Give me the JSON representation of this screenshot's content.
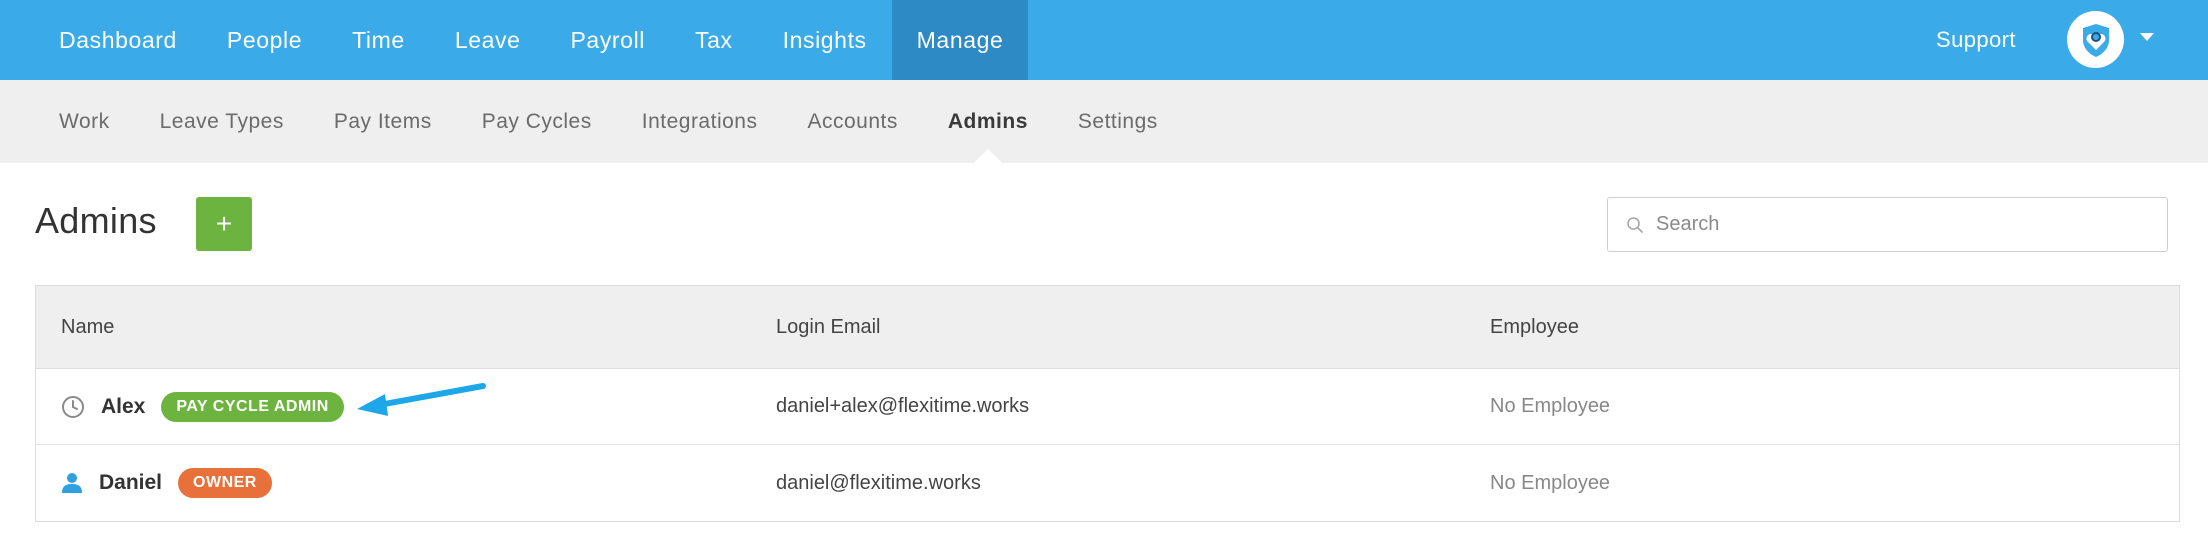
{
  "top_nav": {
    "items": [
      {
        "label": "Dashboard",
        "active": false
      },
      {
        "label": "People",
        "active": false
      },
      {
        "label": "Time",
        "active": false
      },
      {
        "label": "Leave",
        "active": false
      },
      {
        "label": "Payroll",
        "active": false
      },
      {
        "label": "Tax",
        "active": false
      },
      {
        "label": "Insights",
        "active": false
      },
      {
        "label": "Manage",
        "active": true
      }
    ],
    "support_label": "Support",
    "avatar_icon": "shield-heart-icon",
    "menu_icon": "caret-down-icon"
  },
  "sub_nav": {
    "items": [
      {
        "label": "Work",
        "active": false
      },
      {
        "label": "Leave Types",
        "active": false
      },
      {
        "label": "Pay Items",
        "active": false
      },
      {
        "label": "Pay Cycles",
        "active": false
      },
      {
        "label": "Integrations",
        "active": false
      },
      {
        "label": "Accounts",
        "active": false
      },
      {
        "label": "Admins",
        "active": true
      },
      {
        "label": "Settings",
        "active": false
      }
    ]
  },
  "page": {
    "title": "Admins",
    "add_button_label": "+",
    "search_placeholder": "Search"
  },
  "table": {
    "headers": {
      "name": "Name",
      "login_email": "Login Email",
      "employee": "Employee"
    },
    "rows": [
      {
        "icon": "clock-icon",
        "name": "Alex",
        "badge": "PAY CYCLE ADMIN",
        "badge_color": "#6db33f",
        "email": "daniel+alex@flexitime.works",
        "employee": "No Employee"
      },
      {
        "icon": "person-icon",
        "name": "Daniel",
        "badge": "OWNER",
        "badge_color": "#e8703a",
        "email": "daniel@flexitime.works",
        "employee": "No Employee"
      }
    ]
  },
  "colors": {
    "topbar": "#3aabe8",
    "topbar_active": "#2d8ac4",
    "add_button": "#6db33f",
    "annotation_arrow": "#1ea7e8"
  }
}
